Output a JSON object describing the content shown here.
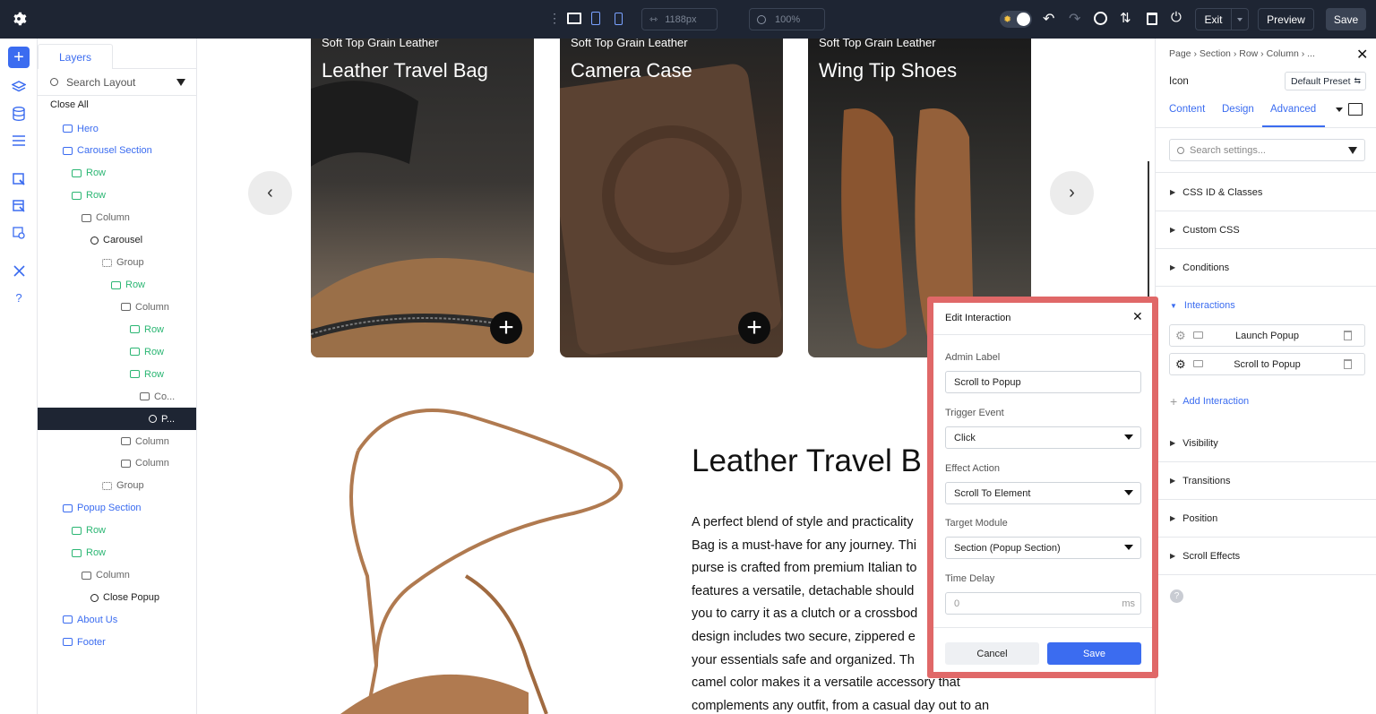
{
  "topbar": {
    "width_value": "1188px",
    "zoom_value": "100%",
    "exit_label": "Exit",
    "preview_label": "Preview",
    "save_label": "Save"
  },
  "layers": {
    "tab_label": "Layers",
    "search_placeholder": "Search Layout",
    "close_all": "Close All",
    "items": [
      {
        "label": "Hero",
        "type": "section"
      },
      {
        "label": "Carousel Section",
        "type": "section"
      },
      {
        "label": "Row",
        "type": "row"
      },
      {
        "label": "Row",
        "type": "row"
      },
      {
        "label": "Column",
        "type": "column"
      },
      {
        "label": "Carousel",
        "type": "module"
      },
      {
        "label": "Group",
        "type": "group"
      },
      {
        "label": "Row",
        "type": "row"
      },
      {
        "label": "Column",
        "type": "column"
      },
      {
        "label": "Row",
        "type": "row"
      },
      {
        "label": "Row",
        "type": "row"
      },
      {
        "label": "Row",
        "type": "row"
      },
      {
        "label": "Co...",
        "type": "column"
      },
      {
        "label": "P...",
        "type": "module-selected"
      },
      {
        "label": "Column",
        "type": "column"
      },
      {
        "label": "Column",
        "type": "column"
      },
      {
        "label": "Group",
        "type": "group"
      },
      {
        "label": "Popup Section",
        "type": "section"
      },
      {
        "label": "Row",
        "type": "row"
      },
      {
        "label": "Row",
        "type": "row"
      },
      {
        "label": "Column",
        "type": "column"
      },
      {
        "label": "Close Popup",
        "type": "module"
      },
      {
        "label": "About Us",
        "type": "section"
      },
      {
        "label": "Footer",
        "type": "section"
      }
    ]
  },
  "canvas": {
    "cards": [
      {
        "caption": "Soft Top Grain Leather",
        "title": "Leather Travel Bag"
      },
      {
        "caption": "Soft Top Grain Leather",
        "title": "Camera Case"
      },
      {
        "caption": "Soft Top Grain Leather",
        "title": "Wing Tip Shoes"
      }
    ],
    "product_heading": "Leather Travel B",
    "description_lines": [
      "A perfect blend of style and practicality",
      "Bag is a must-have for any journey. Thi",
      "purse is crafted from premium Italian to",
      "features a versatile, detachable should",
      "you to carry it as a clutch or a crossbod",
      "design includes two secure, zippered e",
      "your essentials safe and organized. Th",
      "camel color makes it a versatile accessory that",
      "complements any outfit, from a casual day out to an"
    ]
  },
  "right_panel": {
    "breadcrumb": [
      "Page",
      "Section",
      "Row",
      "Column",
      "..."
    ],
    "element_label": "Icon",
    "preset_label": "Default Preset",
    "tabs": [
      "Content",
      "Design",
      "Advanced"
    ],
    "active_tab": "Advanced",
    "search_placeholder": "Search settings...",
    "sections": [
      "CSS ID & Classes",
      "Custom CSS",
      "Conditions",
      "Interactions",
      "Visibility",
      "Transitions",
      "Position",
      "Scroll Effects"
    ],
    "interactions": [
      "Launch Popup",
      "Scroll to Popup"
    ],
    "add_interaction": "Add Interaction"
  },
  "modal": {
    "title": "Edit Interaction",
    "admin_label_label": "Admin Label",
    "admin_label_value": "Scroll to Popup",
    "trigger_label": "Trigger Event",
    "trigger_value": "Click",
    "effect_label": "Effect Action",
    "effect_value": "Scroll To Element",
    "target_label": "Target Module",
    "target_value": "Section (Popup Section)",
    "delay_label": "Time Delay",
    "delay_value": "0",
    "delay_unit": "ms",
    "cancel_label": "Cancel",
    "save_label": "Save"
  },
  "colors": {
    "topbar_bg": "#1e2533",
    "accent": "#3b6cf0",
    "row_green": "#2bb673",
    "modal_highlight": "#e06868"
  }
}
